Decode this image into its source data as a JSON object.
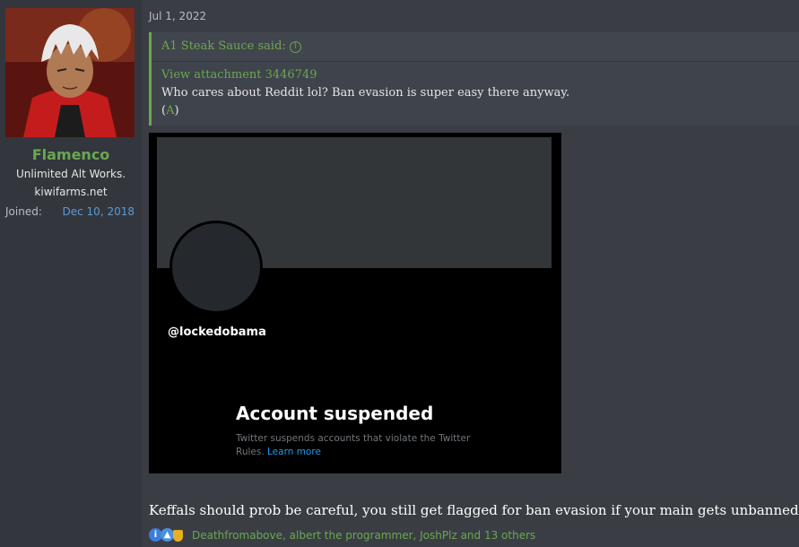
{
  "author": {
    "username": "Flamenco",
    "title": "Unlimited Alt Works.",
    "subtitle": "kiwifarms.net",
    "joined_label": "Joined:",
    "joined_date": "Dec 10, 2018"
  },
  "post": {
    "date": "Jul 1, 2022",
    "quote": {
      "author": "A1 Steak Sauce said:",
      "attachment": "View attachment 3446749",
      "text": "Who cares about Reddit lol? Ban evasion is super easy there anyway.",
      "archive_open": "(",
      "archive_link": "A",
      "archive_close": ")"
    },
    "attachment_image": {
      "handle": "@lockedobama",
      "heading": "Account suspended",
      "body": "Twitter suspends accounts that violate the Twitter Rules.",
      "link": "Learn more"
    },
    "body": "Keffals should prob be careful, you still get flagged for ban evasion if your main gets unbanned",
    "reactions": {
      "icons": [
        "info-icon",
        "like-icon",
        "trophy-icon"
      ],
      "names": "Deathfromabove, albert the programmer, JoshPlz and 13 others"
    }
  },
  "colors": {
    "accent": "#6aa84f",
    "link_blue": "#5b9bd5",
    "background": "#3a3d44"
  }
}
